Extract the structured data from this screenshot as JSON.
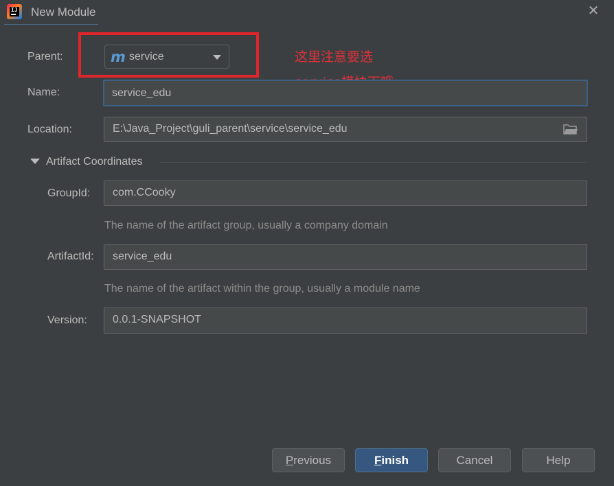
{
  "window": {
    "title": "New Module",
    "close_icon": "close-icon"
  },
  "form": {
    "parent": {
      "label": "Parent:",
      "value": "service",
      "icon": "maven-module-icon"
    },
    "name": {
      "label": "Name:",
      "value": "service_edu"
    },
    "location": {
      "label": "Location:",
      "value": "E:\\Java_Project\\guli_parent\\service\\service_edu",
      "icon": "folder-icon"
    },
    "artifact_section": {
      "label": "Artifact Coordinates"
    },
    "group_id": {
      "label": "GroupId:",
      "value": "com.CCooky",
      "hint": "The name of the artifact group, usually a company domain"
    },
    "artifact_id": {
      "label": "ArtifactId:",
      "value": "service_edu",
      "hint": "The name of the artifact within the group, usually a module name"
    },
    "version": {
      "label": "Version:",
      "value": "0.0.1-SNAPSHOT"
    }
  },
  "annotation": {
    "line1": "这里注意要选",
    "line2": "service模块下哦",
    "color": "#e0303a"
  },
  "buttons": {
    "previous": {
      "mnemonic": "P",
      "rest": "revious"
    },
    "finish": {
      "mnemonic": "F",
      "rest": "inish"
    },
    "cancel": "Cancel",
    "help": "Help"
  },
  "colors": {
    "background": "#3c3f41",
    "field_bg": "#45494a",
    "primary_button": "#365880",
    "accent_red": "#e0252b",
    "focus_border": "#3d6185"
  }
}
